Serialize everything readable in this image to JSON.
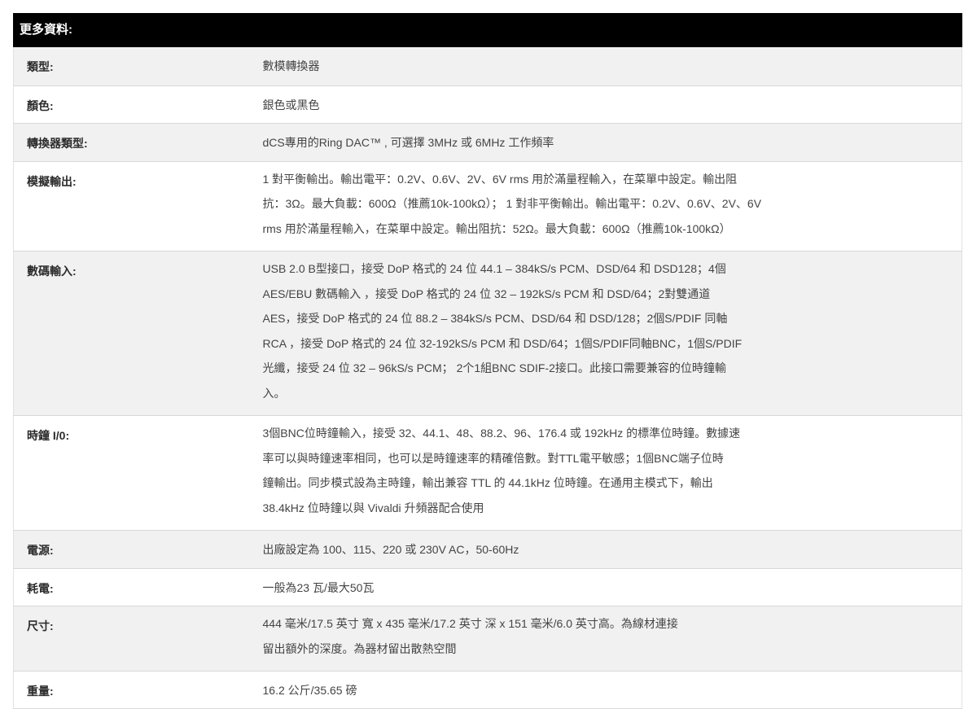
{
  "header": {
    "title": "更多資料:"
  },
  "rows": [
    {
      "label": "類型:",
      "lines": [
        "數模轉換器"
      ]
    },
    {
      "label": "顏色:",
      "lines": [
        "銀色或黑色"
      ]
    },
    {
      "label": "轉換器類型:",
      "lines": [
        "dCS專用的Ring DAC™ , 可選擇 3MHz 或 6MHz 工作頻率"
      ]
    },
    {
      "label": "模擬輸出:",
      "lines": [
        "1 對平衡輸出。輸出電平：0.2V、0.6V、2V、6V rms 用於滿量程輸入，在菜單中設定。輸出阻",
        "抗：3Ω。最大負載：600Ω（推薦10k-100kΩ）； 1 對非平衡輸出。輸出電平：0.2V、0.6V、2V、6V",
        "rms 用於滿量程輸入，在菜單中設定。輸出阻抗：52Ω。最大負載：600Ω（推薦10k-100kΩ）"
      ]
    },
    {
      "label": "數碼輸入:",
      "lines": [
        "USB 2.0 B型接口，接受 DoP 格式的 24 位 44.1 – 384kS/s PCM、DSD/64 和 DSD128；4個",
        "AES/EBU 數碼輸入 ，接受 DoP 格式的 24 位 32 – 192kS/s PCM 和 DSD/64；2對雙通道",
        "AES，接受 DoP 格式的 24 位 88.2 – 384kS/s PCM、DSD/64 和 DSD/128；2個S/PDIF 同軸",
        "RCA ，接受 DoP 格式的 24 位 32-192kS/s PCM 和 DSD/64；1個S/PDIF同軸BNC，1個S/PDIF",
        "光纖，接受 24 位 32 – 96kS/s PCM； 2个1組BNC SDIF-2接口。此接口需要兼容的位時鐘輸",
        "入。"
      ]
    },
    {
      "label": "時鐘 I/0:",
      "lines": [
        "3個BNC位時鐘輸入，接受 32、44.1、48、88.2、96、176.4 或 192kHz 的標準位時鐘。數據速",
        "率可以與時鐘速率相同，也可以是時鐘速率的精確倍數。對TTL電平敏感；1個BNC端子位時",
        "鐘輸出。同步模式設為主時鐘，輸出兼容 TTL 的 44.1kHz 位時鐘。在通用主模式下，輸出",
        "38.4kHz 位時鐘以與 Vivaldi 升頻器配合使用"
      ]
    },
    {
      "label": "電源:",
      "lines": [
        "出廠設定為 100、115、220 或 230V AC，50-60Hz"
      ]
    },
    {
      "label": "耗電:",
      "lines": [
        "一般為23 瓦/最大50瓦"
      ]
    },
    {
      "label": "尺寸:",
      "lines": [
        "444 毫米/17.5 英寸 寬 x 435 毫米/17.2 英寸 深 x 151 毫米/6.0 英寸高。為線材連接",
        "留出額外的深度。為器材留出散熱空間"
      ]
    },
    {
      "label": "重量:",
      "lines": [
        "16.2 公斤/35.65 磅"
      ]
    }
  ]
}
